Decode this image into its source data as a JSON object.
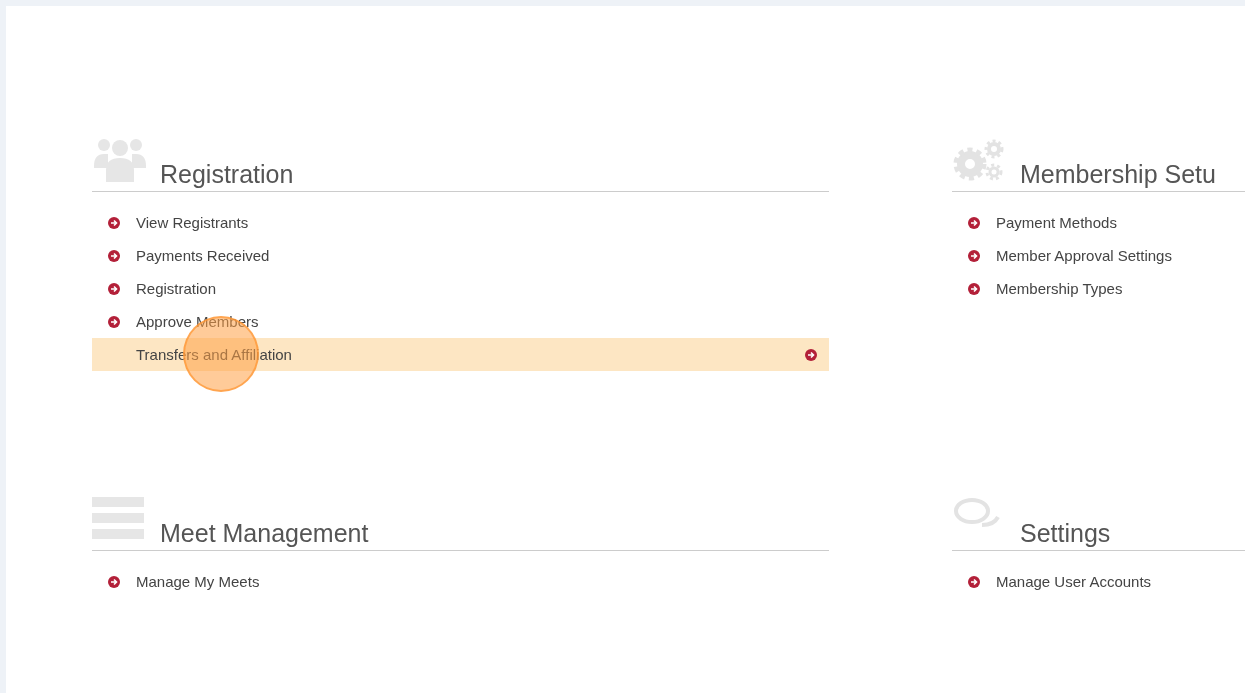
{
  "sections": [
    {
      "title": "Registration",
      "kind": "users",
      "items": [
        {
          "label": "View Registrants",
          "selected": false
        },
        {
          "label": "Payments Received",
          "selected": false
        },
        {
          "label": "Registration",
          "selected": false
        },
        {
          "label": "Approve Members",
          "selected": false
        },
        {
          "label": "Transfers and Affiliation",
          "selected": true
        }
      ]
    },
    {
      "title": "Membership Setu",
      "kind": "gears",
      "items": [
        {
          "label": "Payment Methods",
          "selected": false
        },
        {
          "label": "Member Approval Settings",
          "selected": false
        },
        {
          "label": "Membership Types",
          "selected": false
        }
      ]
    },
    {
      "title": "Meet Management",
      "kind": "list",
      "items": [
        {
          "label": "Manage My Meets",
          "selected": false
        }
      ]
    },
    {
      "title": "Settings",
      "kind": "chat",
      "items": [
        {
          "label": "Manage User Accounts",
          "selected": false
        }
      ]
    }
  ]
}
